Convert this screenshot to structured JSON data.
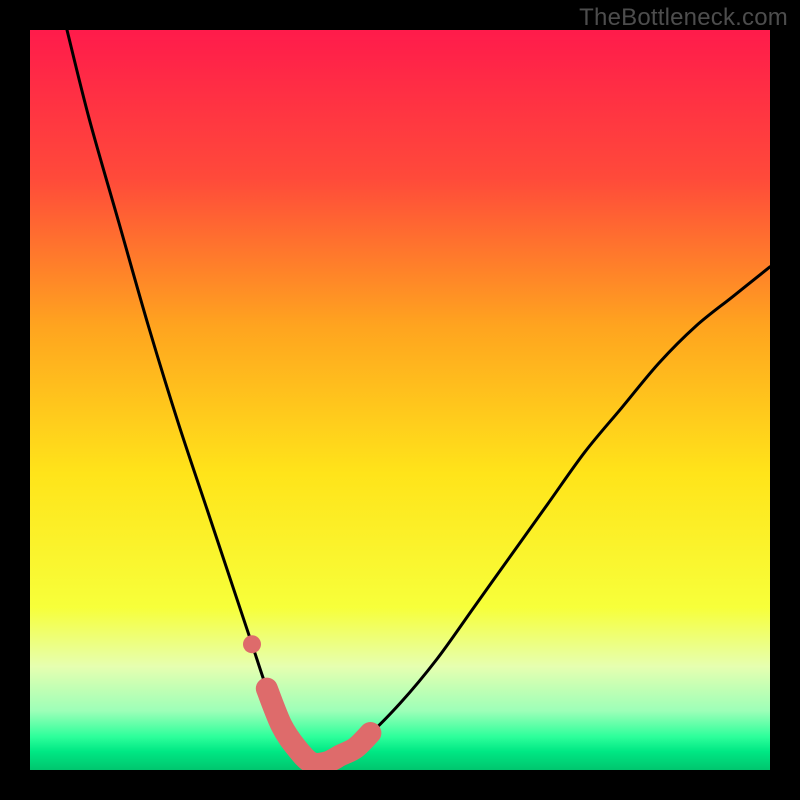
{
  "watermark": "TheBottleneck.com",
  "colors": {
    "frame": "#000000",
    "gradient_stops": [
      {
        "offset": 0.0,
        "color": "#ff1b4b"
      },
      {
        "offset": 0.2,
        "color": "#ff4a3a"
      },
      {
        "offset": 0.4,
        "color": "#ffa41f"
      },
      {
        "offset": 0.6,
        "color": "#ffe41a"
      },
      {
        "offset": 0.78,
        "color": "#f7ff3a"
      },
      {
        "offset": 0.86,
        "color": "#e6ffb0"
      },
      {
        "offset": 0.92,
        "color": "#9dffb8"
      },
      {
        "offset": 0.955,
        "color": "#2dff9b"
      },
      {
        "offset": 0.975,
        "color": "#00e884"
      },
      {
        "offset": 1.0,
        "color": "#00c56e"
      }
    ],
    "curve": "#000000",
    "marker_stroke": "#de6b6b",
    "marker_fill": "#de6b6b"
  },
  "chart_data": {
    "type": "line",
    "title": "",
    "xlabel": "",
    "ylabel": "",
    "xlim": [
      0,
      100
    ],
    "ylim": [
      0,
      100
    ],
    "grid": false,
    "legend": false,
    "note": "Bottleneck-style V-curve. y ≈ percentage bottleneck (0 at optimum). x ≈ relative GPU/CPU balance. Unlabeled axes; values estimated from pixel geometry.",
    "series": [
      {
        "name": "bottleneck-curve",
        "x": [
          5,
          8,
          12,
          16,
          20,
          24,
          28,
          30,
          32,
          34,
          36,
          38,
          40,
          42,
          45,
          50,
          55,
          60,
          65,
          70,
          75,
          80,
          85,
          90,
          95,
          100
        ],
        "y": [
          100,
          88,
          74,
          60,
          47,
          35,
          23,
          17,
          11,
          6,
          3,
          1,
          1,
          2,
          4,
          9,
          15,
          22,
          29,
          36,
          43,
          49,
          55,
          60,
          64,
          68
        ]
      }
    ],
    "markers": {
      "name": "highlight-segment",
      "note": "Thick salmon marker hugging the trough of the curve plus one detached dot on the left branch.",
      "detached_point": {
        "x": 30,
        "y": 17
      },
      "segment_x": [
        32,
        34,
        36,
        38,
        40,
        42,
        44,
        46
      ],
      "segment_y": [
        11,
        6,
        3,
        1,
        1,
        2,
        3,
        5
      ]
    }
  }
}
